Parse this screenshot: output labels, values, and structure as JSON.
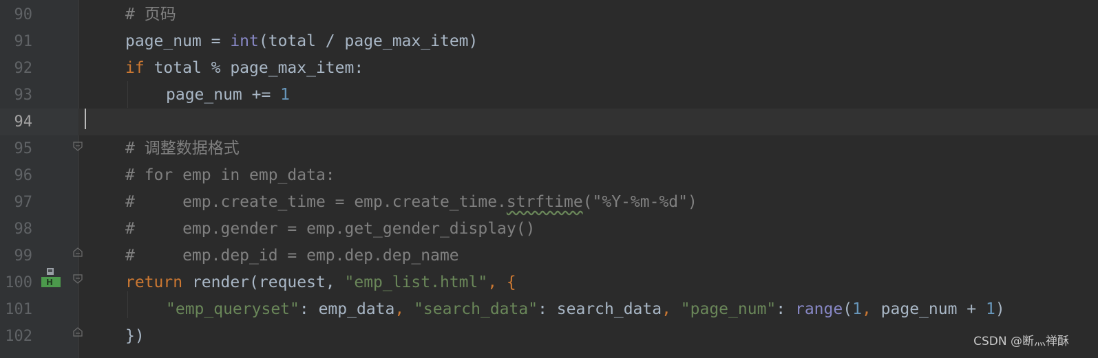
{
  "editor": {
    "lines": [
      {
        "number": "90",
        "parts": [
          {
            "t": "# 页码",
            "c": "cm"
          }
        ]
      },
      {
        "number": "91",
        "parts": [
          {
            "t": "page_num = ",
            "c": ""
          },
          {
            "t": "int",
            "c": "bi"
          },
          {
            "t": "(total / page_max_item)",
            "c": ""
          }
        ]
      },
      {
        "number": "92",
        "parts": [
          {
            "t": "if",
            "c": "kw"
          },
          {
            "t": " total % page_max_item:",
            "c": ""
          }
        ]
      },
      {
        "number": "93",
        "parts": [
          {
            "t": "page_num += ",
            "c": ""
          },
          {
            "t": "1",
            "c": "num"
          }
        ]
      },
      {
        "number": "94",
        "parts": []
      },
      {
        "number": "95",
        "parts": [
          {
            "t": "# 调整数据格式",
            "c": "cm"
          }
        ]
      },
      {
        "number": "96",
        "parts": [
          {
            "t": "# for emp in emp_data:",
            "c": "cm"
          }
        ]
      },
      {
        "number": "97",
        "parts": [
          {
            "t": "#     emp.create_time = emp.create_time.",
            "c": "cm"
          },
          {
            "t": "strftime",
            "c": "cm squiggle"
          },
          {
            "t": "(\"%Y-%m-%d\")",
            "c": "cm"
          }
        ]
      },
      {
        "number": "98",
        "parts": [
          {
            "t": "#     emp.gender = emp.get_gender_display()",
            "c": "cm"
          }
        ]
      },
      {
        "number": "99",
        "parts": [
          {
            "t": "#     emp.dep_id = emp.dep.dep_name",
            "c": "cm"
          }
        ]
      },
      {
        "number": "100",
        "parts": [
          {
            "t": "return",
            "c": "kw"
          },
          {
            "t": " render(request, ",
            "c": ""
          },
          {
            "t": "\"emp_list.html\"",
            "c": "str"
          },
          {
            "t": ", {",
            "c": "kw"
          }
        ]
      },
      {
        "number": "101",
        "parts": [
          {
            "t": "\"emp_queryset\"",
            "c": "str"
          },
          {
            "t": ": emp_data",
            "c": ""
          },
          {
            "t": ", ",
            "c": "kw"
          },
          {
            "t": "\"search_data\"",
            "c": "str"
          },
          {
            "t": ": search_data",
            "c": ""
          },
          {
            "t": ", ",
            "c": "kw"
          },
          {
            "t": "\"page_num\"",
            "c": "str"
          },
          {
            "t": ": ",
            "c": ""
          },
          {
            "t": "range",
            "c": "bi"
          },
          {
            "t": "(",
            "c": ""
          },
          {
            "t": "1",
            "c": "num"
          },
          {
            "t": ", ",
            "c": "kw"
          },
          {
            "t": "page_num + ",
            "c": ""
          },
          {
            "t": "1",
            "c": "num"
          },
          {
            "t": ")",
            "c": ""
          }
        ]
      },
      {
        "number": "102",
        "parts": [
          {
            "t": "})",
            "c": ""
          }
        ]
      }
    ],
    "current_line": "94",
    "gutter_icons": [
      "fold-start-icon",
      "fold-end-icon",
      "hierarchy-marker-icon"
    ]
  },
  "watermark": "CSDN @断灬禅酥",
  "colors": {
    "background": "#2b2b2b",
    "gutter": "#313335",
    "keyword": "#cc7832",
    "builtin": "#8888c6",
    "number": "#6897bb",
    "string": "#6a8759",
    "comment": "#808080",
    "text": "#a9b7c6"
  }
}
